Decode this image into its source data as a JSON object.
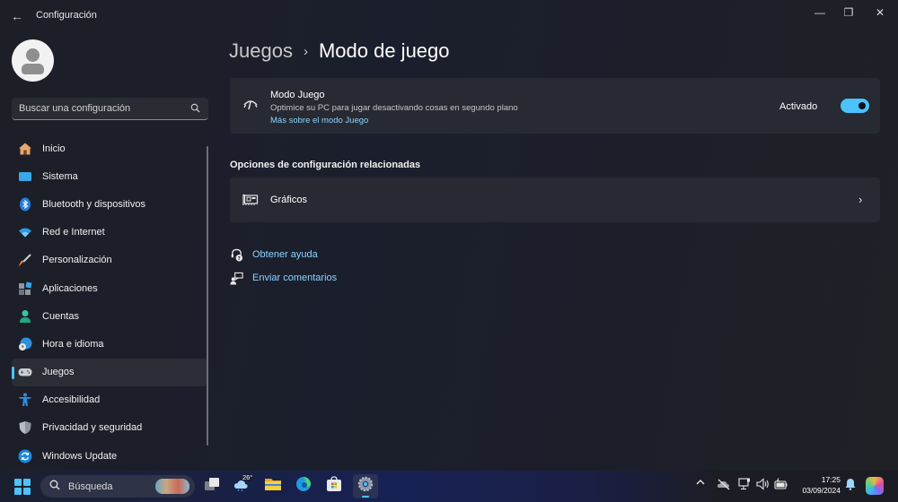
{
  "window": {
    "title": "Configuración",
    "controls": {
      "minimize": "—",
      "maximize": "❐",
      "close": "✕"
    },
    "back_icon": "arrow-left-icon"
  },
  "sidebar": {
    "search_placeholder": "Buscar una configuración",
    "items": [
      {
        "label": "Inicio",
        "icon": "home-icon",
        "active": false
      },
      {
        "label": "Sistema",
        "icon": "system-icon",
        "active": false
      },
      {
        "label": "Bluetooth y dispositivos",
        "icon": "bluetooth-icon",
        "active": false
      },
      {
        "label": "Red e Internet",
        "icon": "wifi-icon",
        "active": false
      },
      {
        "label": "Personalización",
        "icon": "brush-icon",
        "active": false
      },
      {
        "label": "Aplicaciones",
        "icon": "apps-icon",
        "active": false
      },
      {
        "label": "Cuentas",
        "icon": "account-icon",
        "active": false
      },
      {
        "label": "Hora e idioma",
        "icon": "time-language-icon",
        "active": false
      },
      {
        "label": "Juegos",
        "icon": "gamepad-icon",
        "active": true
      },
      {
        "label": "Accesibilidad",
        "icon": "accessibility-icon",
        "active": false
      },
      {
        "label": "Privacidad y seguridad",
        "icon": "shield-icon",
        "active": false
      },
      {
        "label": "Windows Update",
        "icon": "update-icon",
        "active": false
      }
    ]
  },
  "main": {
    "breadcrumb": {
      "parent": "Juegos",
      "separator": "›",
      "current": "Modo de juego"
    },
    "game_mode": {
      "title": "Modo Juego",
      "description": "Optimice su PC para jugar desactivando cosas en segundo plano",
      "link": "Más sobre el modo Juego",
      "state_label": "Activado",
      "enabled": true
    },
    "related_title": "Opciones de configuración relacionadas",
    "related": [
      {
        "label": "Gráficos",
        "icon": "graphics-card-icon"
      }
    ],
    "help_links": [
      {
        "label": "Obtener ayuda",
        "icon": "help-icon"
      },
      {
        "label": "Enviar comentarios",
        "icon": "feedback-icon"
      }
    ]
  },
  "taskbar": {
    "search_placeholder": "Búsqueda",
    "weather_temp": "26°",
    "apps": [
      "task-view",
      "weather",
      "file-explorer",
      "edge",
      "store",
      "settings"
    ],
    "active_app": "settings",
    "clock": {
      "time": "17:25",
      "date": "03/09/2024"
    },
    "accent": "#4cc2ff"
  }
}
